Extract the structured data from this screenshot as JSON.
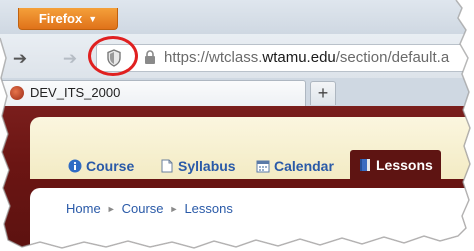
{
  "browser": {
    "menu_button_label": "Firefox",
    "menu_arrow": "▼",
    "back_icon": "back-arrow-icon",
    "forward_icon": "forward-arrow-icon",
    "url_prefix": "https://wtclass.",
    "url_host": "wtamu.edu",
    "url_path": "/section/default.a"
  },
  "tabs": [
    {
      "label": "DEV_ITS_2000"
    }
  ],
  "new_tab_label": "+",
  "course_tabs": [
    {
      "label": "Course",
      "icon": "info-icon"
    },
    {
      "label": "Syllabus",
      "icon": "document-icon"
    },
    {
      "label": "Calendar",
      "icon": "calendar-icon"
    },
    {
      "label": "Lessons",
      "icon": "book-icon",
      "active": true
    }
  ],
  "breadcrumb": {
    "items": [
      "Home",
      "Course",
      "Lessons"
    ],
    "separator": "►"
  },
  "colors": {
    "firefox_orange": "#e0721a",
    "highlight_circle": "#e02020",
    "page_maroon": "#6b1513",
    "link_blue": "#2a5aa8"
  }
}
